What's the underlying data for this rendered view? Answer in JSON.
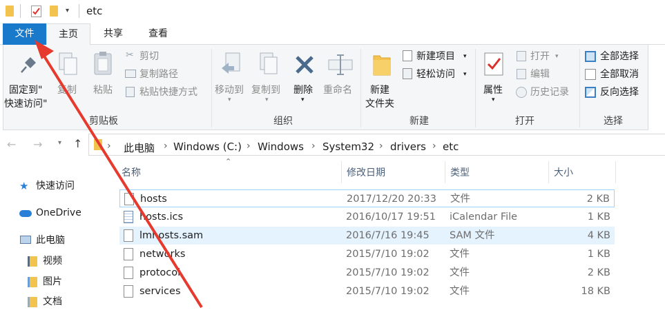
{
  "titlebar": {
    "title": "etc"
  },
  "tabs": [
    {
      "label": "文件"
    },
    {
      "label": "主页"
    },
    {
      "label": "共享"
    },
    {
      "label": "查看"
    }
  ],
  "ribbon": {
    "clipboard": {
      "group_label": "剪贴板",
      "pin_line1": "固定到\"",
      "pin_line2": "快速访问\"",
      "copy": "复制",
      "paste": "粘贴",
      "cut": "剪切",
      "copy_path": "复制路径",
      "paste_shortcut": "粘贴快捷方式"
    },
    "organize": {
      "group_label": "组织",
      "move_to": "移动到",
      "copy_to": "复制到",
      "delete": "删除",
      "rename": "重命名"
    },
    "new": {
      "group_label": "新建",
      "new_folder_line1": "新建",
      "new_folder_line2": "文件夹",
      "new_item": "新建项目",
      "easy_access": "轻松访问"
    },
    "open": {
      "group_label": "打开",
      "properties": "属性",
      "open": "打开",
      "edit": "编辑",
      "history": "历史记录"
    },
    "select": {
      "group_label": "选择",
      "select_all": "全部选择",
      "select_none": "全部取消",
      "invert": "反向选择"
    }
  },
  "address": {
    "crumbs": [
      "此电脑",
      "Windows (C:)",
      "Windows",
      "System32",
      "drivers",
      "etc"
    ]
  },
  "nav": {
    "quick_access": "快速访问",
    "onedrive": "OneDrive",
    "this_pc": "此电脑",
    "videos": "视频",
    "pictures": "图片",
    "documents": "文档"
  },
  "columns": {
    "name": "名称",
    "date": "修改日期",
    "type": "类型",
    "size": "大小"
  },
  "files": [
    {
      "name": "hosts",
      "date": "2017/12/20 20:33",
      "type": "文件",
      "size": "2 KB"
    },
    {
      "name": "hosts.ics",
      "date": "2016/10/17 19:51",
      "type": "iCalendar File",
      "size": "1 KB"
    },
    {
      "name": "lmhosts.sam",
      "date": "2016/7/16 19:45",
      "type": "SAM 文件",
      "size": "4 KB"
    },
    {
      "name": "networks",
      "date": "2015/7/10 19:02",
      "type": "文件",
      "size": "1 KB"
    },
    {
      "name": "protocol",
      "date": "2015/7/10 19:02",
      "type": "文件",
      "size": "2 KB"
    },
    {
      "name": "services",
      "date": "2015/7/10 19:02",
      "type": "文件",
      "size": "18 KB"
    }
  ],
  "colors": {
    "accent": "#1979ca",
    "arrow": "#e63a2e",
    "selected_row": "#cce8ff",
    "hover_border": "#99d1ff"
  }
}
